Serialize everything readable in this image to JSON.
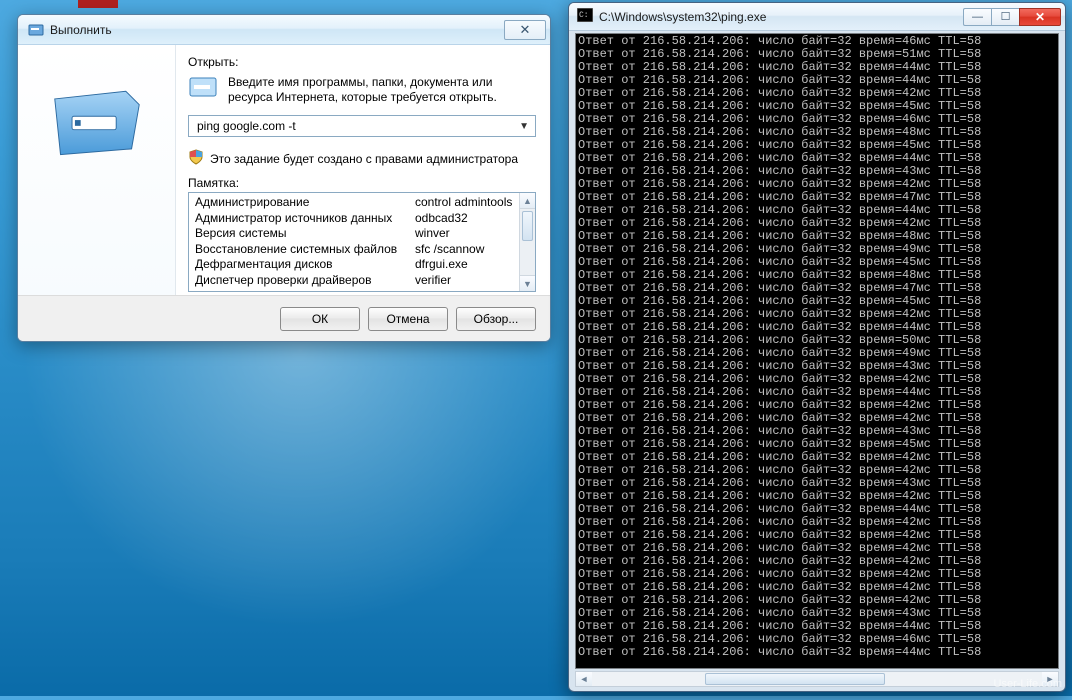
{
  "run_dialog": {
    "title": "Выполнить",
    "open_label": "Открыть:",
    "hint_text": "Введите имя программы, папки, документа или ресурса Интернета, которые требуется открыть.",
    "command_value": "ping google.com -t",
    "admin_text": "Это задание будет создано с правами администратора",
    "memo_label": "Памятка:",
    "memo": [
      {
        "name": "Администрирование",
        "cmd": "control admintools"
      },
      {
        "name": "Администратор источников данных",
        "cmd": "odbcad32"
      },
      {
        "name": "Версия системы",
        "cmd": "winver"
      },
      {
        "name": "Восстановление системных файлов",
        "cmd": "sfc /scannow"
      },
      {
        "name": "Дефрагментация дисков",
        "cmd": "dfrgui.exe"
      },
      {
        "name": "Диспетчер проверки драйверов",
        "cmd": "verifier"
      }
    ],
    "ok_label": "ОК",
    "cancel_label": "Отмена",
    "browse_label": "Обзор..."
  },
  "console": {
    "title": "C:\\Windows\\system32\\ping.exe",
    "line_prefix": "Ответ от ",
    "ip": "216.58.214.206",
    "bytes_label": "число байт=32",
    "time_label_prefix": "время=",
    "time_label_suffix": "мс",
    "ttl_label": "TTL=58",
    "times_ms": [
      46,
      51,
      44,
      44,
      42,
      45,
      46,
      48,
      45,
      44,
      43,
      42,
      47,
      44,
      42,
      48,
      49,
      45,
      48,
      47,
      45,
      42,
      44,
      50,
      49,
      43,
      42,
      44,
      42,
      42,
      43,
      45,
      42,
      42,
      43,
      42,
      44,
      42,
      42,
      42,
      42,
      42,
      42,
      42,
      43,
      44,
      46,
      44
    ]
  },
  "watermark": "User-Life.com"
}
